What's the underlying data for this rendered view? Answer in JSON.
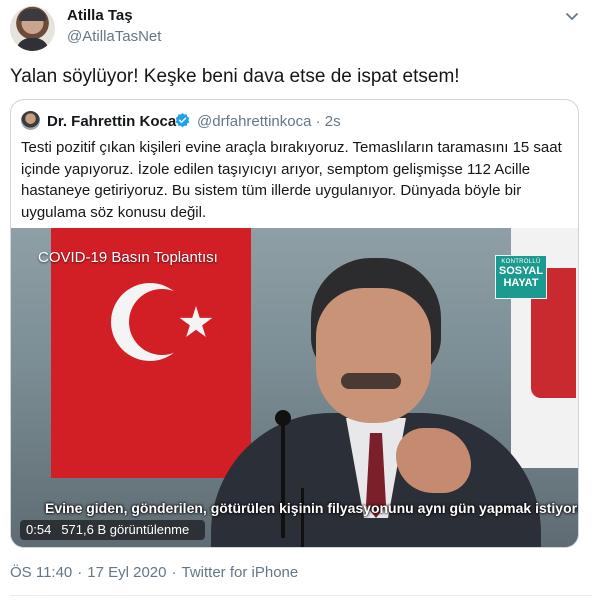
{
  "author": {
    "name": "Atilla Taş",
    "handle": "@AtillaTasNet"
  },
  "tweet": {
    "text": "Yalan söylüyor! Keşke beni dava etse de ispat etsem!"
  },
  "quoted_tweet": {
    "name": "Dr. Fahrettin Koca",
    "handle": "@drfahrettinkoca · 2s",
    "text": "Testi pozitif çıkan kişileri evine araçla bırakıyoruz. Temaslıların taramasını 15 saat içinde yapıyoruz. İzole edilen taşıyıcıyı arıyor, semptom gelişmişse 112 Acille hastaneye getiriyoruz. Bu sistem tüm illerde uygulanıyor. Dünyada böyle bir uygulama söz konusu değil.",
    "video": {
      "overlay_title": "COVID-19 Basın Toplantısı",
      "badge_line1": "KONTROLLÜ",
      "badge_line2": "SOSYAL",
      "badge_line3": "HAYAT",
      "subtitle": "Evine giden, gönderilen, götürülen kişinin filyasyonunu aynı gün yapmak istiyoruz,",
      "duration": "0:54",
      "views": "571,6 B görüntülenme"
    }
  },
  "meta": {
    "time": "ÖS 11:40",
    "separator": "·",
    "date": "17 Eyl 2020",
    "source": "Twitter for iPhone"
  },
  "colors": {
    "secondary_text": "#657786",
    "verified_blue": "#1da1f2",
    "border": "#ccd6dd"
  }
}
